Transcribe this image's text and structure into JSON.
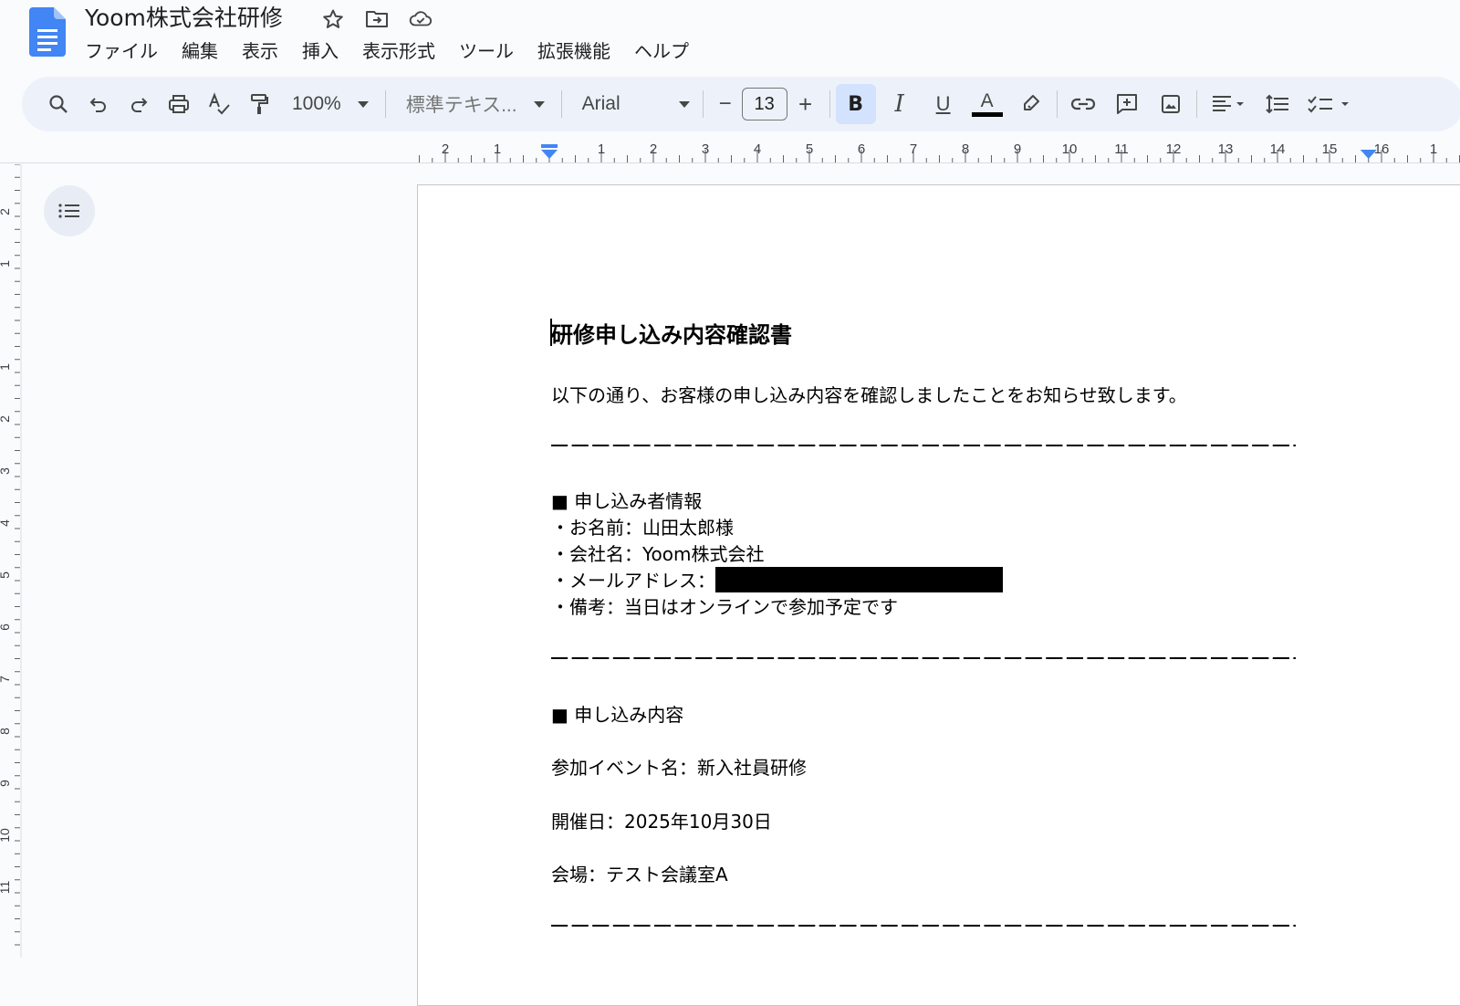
{
  "app": {
    "doc_title": "Yoom株式会社研修",
    "icons": [
      "star-icon",
      "move-to-folder-icon",
      "cloud-saved-icon"
    ]
  },
  "menu": [
    "ファイル",
    "編集",
    "表示",
    "挿入",
    "表示形式",
    "ツール",
    "拡張機能",
    "ヘルプ"
  ],
  "toolbar": {
    "zoom": "100%",
    "style": "標準テキス...",
    "font": "Arial",
    "font_size": "13",
    "decrease": "−",
    "increase": "+",
    "bold": "B",
    "italic": "I",
    "underline": "U",
    "text_color_letter": "A",
    "text_color": "#000000",
    "accent": "#d3e3fd"
  },
  "ruler": {
    "h_left_labels": [
      "2",
      "1"
    ],
    "h_labels": [
      "1",
      "2",
      "3",
      "4",
      "5",
      "6",
      "7",
      "8",
      "9",
      "10",
      "11",
      "12",
      "13",
      "14",
      "15",
      "16",
      "1"
    ],
    "v_labels": [
      "2",
      "1",
      "1",
      "2",
      "3",
      "4",
      "5",
      "6",
      "7",
      "8",
      "9",
      "10",
      "11"
    ]
  },
  "document": {
    "heading": "研修申し込み内容確認書",
    "intro": "以下の通り、お客様の申し込み内容を確認しましたことをお知らせ致します。",
    "section1_title": "■ 申し込み者情報",
    "name": "・お名前：山田太郎様",
    "company": "・会社名：Yoom株式会社",
    "email_label": "・メールアドレス：",
    "note": "・備考：当日はオンラインで参加予定です",
    "section2_title": "■ 申し込み内容",
    "event": "参加イベント名：新入社員研修",
    "date": "開催日：2025年10月30日",
    "venue": "会場：テスト会議室A"
  }
}
